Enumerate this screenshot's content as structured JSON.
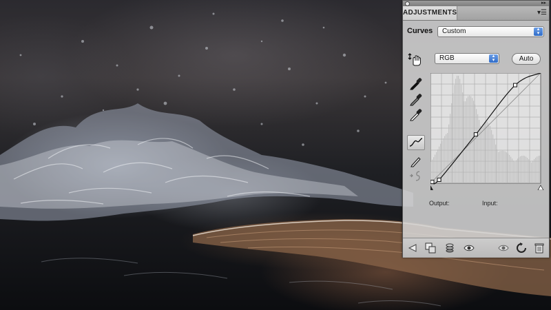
{
  "panel": {
    "tab_label": "ADJUSTMENTS",
    "menu_icon": "panel-menu-icon",
    "collapse_icon": "collapse-icon",
    "close_icon": "close-icon"
  },
  "curves": {
    "title": "Curves",
    "preset_value": "Custom",
    "channel_value": "RGB",
    "auto_label": "Auto",
    "output_label": "Output:",
    "input_label": "Input:",
    "output_value": "",
    "input_value": "",
    "curve_points_levels": [
      [
        4,
        3
      ],
      [
        20,
        8
      ],
      [
        105,
        113
      ],
      [
        196,
        227
      ],
      [
        255,
        255
      ]
    ]
  },
  "tools": {
    "hand": "on-image-adjust-icon",
    "eyedroppers": [
      "black-point-eyedropper-icon",
      "gray-point-eyedropper-icon",
      "white-point-eyedropper-icon"
    ],
    "curve_mode": "point-curve-icon",
    "pencil_mode": "pencil-draw-icon",
    "smooth": "smooth-curve-icon"
  },
  "bottom_icons": [
    "back-arrow-icon",
    "expand-view-icon",
    "clip-layer-icon",
    "visibility-eye-icon",
    "previous-state-icon",
    "reset-icon",
    "trash-icon"
  ],
  "colors": {
    "select_blue": "#2f6cc8",
    "panel_bg": "#d6d6d6"
  }
}
